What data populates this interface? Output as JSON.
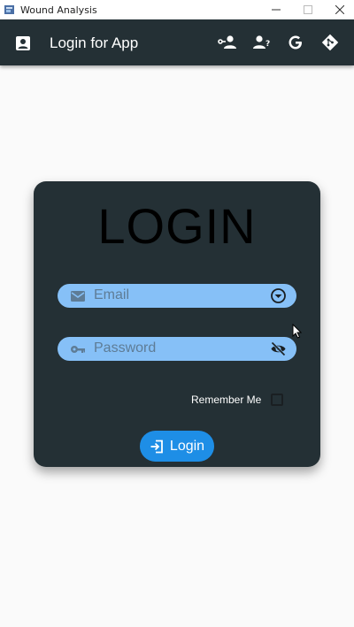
{
  "window": {
    "title": "Wound Analysis"
  },
  "appbar": {
    "title": "Login for App",
    "actions": [
      "person-add-icon",
      "person-help-icon",
      "google-icon",
      "git-icon"
    ]
  },
  "card": {
    "heading": "LOGIN",
    "email_placeholder": "Email",
    "password_placeholder": "Password",
    "remember_label": "Remember Me",
    "remember_checked": false,
    "login_label": "Login"
  },
  "colors": {
    "appbar_bg": "#243035",
    "card_bg": "#243035",
    "field_bg": "#86c0f7",
    "button_bg": "#1e8ee6",
    "page_bg": "#fafafa"
  }
}
